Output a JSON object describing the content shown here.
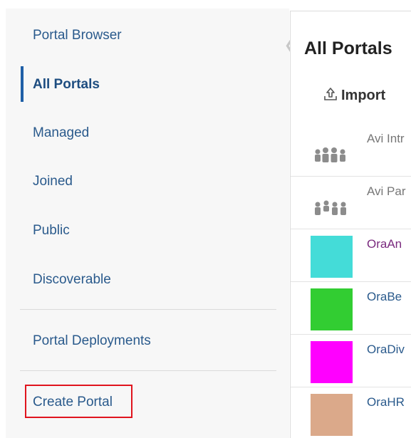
{
  "sidebar": {
    "items": [
      {
        "label": "Portal Browser"
      },
      {
        "label": "All Portals"
      },
      {
        "label": "Managed"
      },
      {
        "label": "Joined"
      },
      {
        "label": "Public"
      },
      {
        "label": "Discoverable"
      },
      {
        "label": "Portal Deployments"
      },
      {
        "label": "Create Portal"
      }
    ],
    "active": "All Portals"
  },
  "main": {
    "title": "All Portals",
    "import_label": "Import",
    "portals": [
      {
        "name": "Avi Intr",
        "icon": "group-icon",
        "name_color": "#777777"
      },
      {
        "name": "Avi Par",
        "icon": "people-icon",
        "name_color": "#777777"
      },
      {
        "name": "OraAn",
        "color": "#44dcd8",
        "name_color": "#7a2a7e"
      },
      {
        "name": "OraBe",
        "color": "#32cd32",
        "name_color": "#2a5a8c"
      },
      {
        "name": "OraDiv",
        "color": "#ff00ff",
        "name_color": "#2a5a8c"
      },
      {
        "name": "OraHR",
        "color": "#dba98a",
        "name_color": "#2a5a8c"
      }
    ]
  },
  "colors": {
    "accent": "#1f5fa7",
    "link": "#2a5a8c",
    "highlight_box": "#e0141e"
  }
}
